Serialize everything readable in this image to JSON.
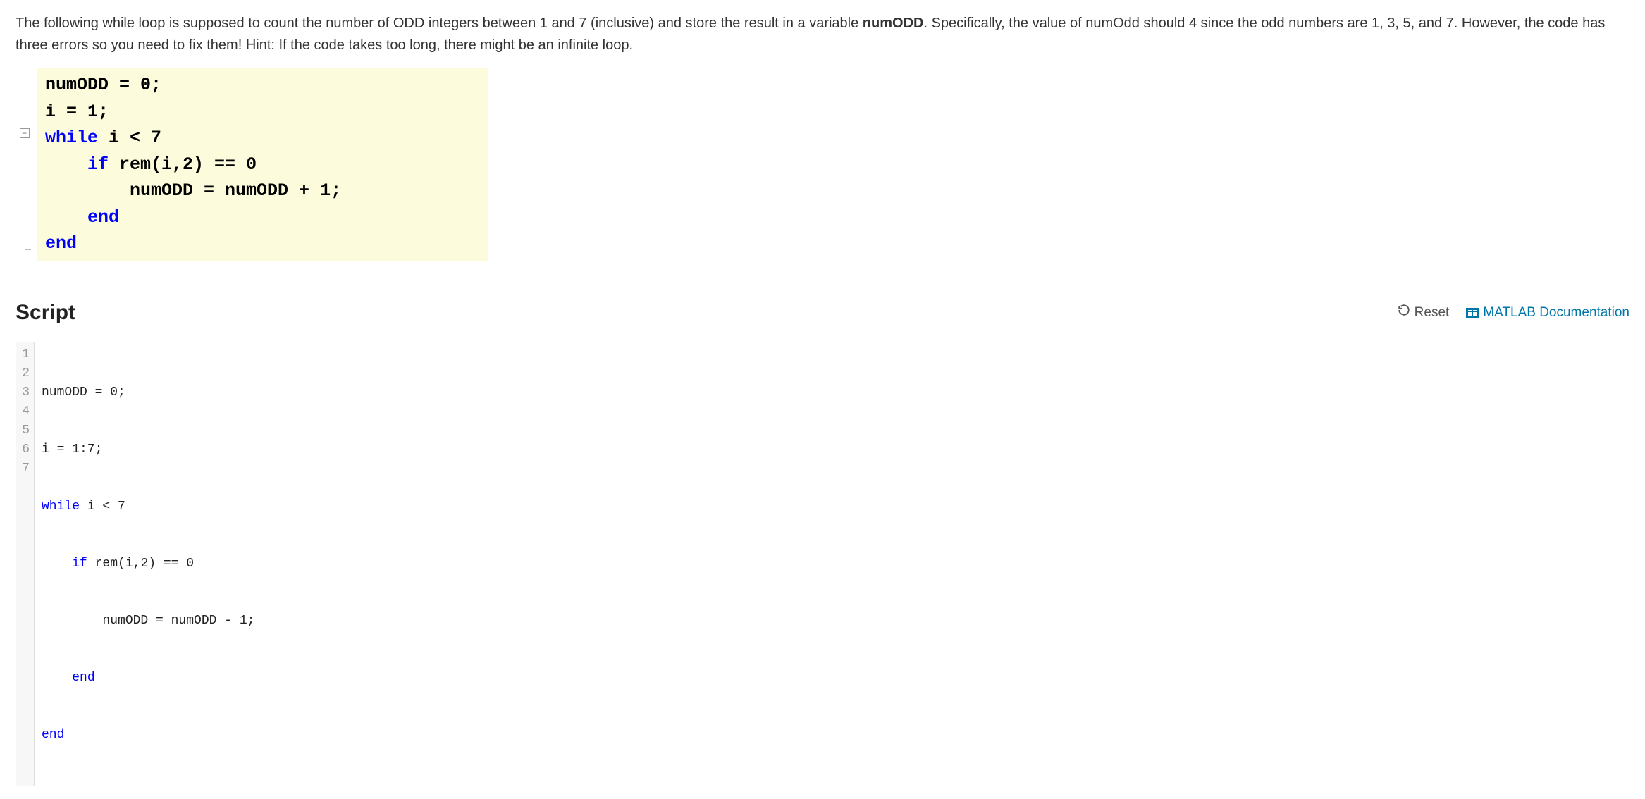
{
  "intro": {
    "part1": "The following while loop is supposed to count the number of ODD integers  between 1 and 7 (inclusive) and store the result in a variable ",
    "bold_var": "numODD",
    "part2": ".   Specifically, the value of numOdd should 4 since the odd numbers are 1, 3, 5, and 7. However, the code has three errors so you need to fix them! Hint: If the code takes too long, there might be an infinite loop."
  },
  "displayed_code": {
    "line1_a": "numODD = 0;",
    "line2_a": "i = 1;",
    "line3_kw": "while",
    "line3_rest": " i < 7",
    "line4_indent": "    ",
    "line4_kw": "if",
    "line4_rest": " rem(i,2) == 0",
    "line5": "        numODD = numODD + 1;",
    "line6_indent": "    ",
    "line6_kw": "end",
    "line7_kw": "end"
  },
  "script": {
    "title": "Script",
    "reset_label": "Reset",
    "doc_label": "MATLAB Documentation"
  },
  "editor_code": {
    "line_numbers": [
      "1",
      "2",
      "3",
      "4",
      "5",
      "6",
      "7"
    ],
    "l1": "numODD = 0;",
    "l2": "i = 1:7;",
    "l3_kw": "while",
    "l3_rest": " i < 7",
    "l4_indent": "    ",
    "l4_kw": "if",
    "l4_rest": " rem(i,2) == 0",
    "l5": "        numODD = numODD - 1;",
    "l6_indent": "    ",
    "l6_kw": "end",
    "l7_kw": "end"
  }
}
